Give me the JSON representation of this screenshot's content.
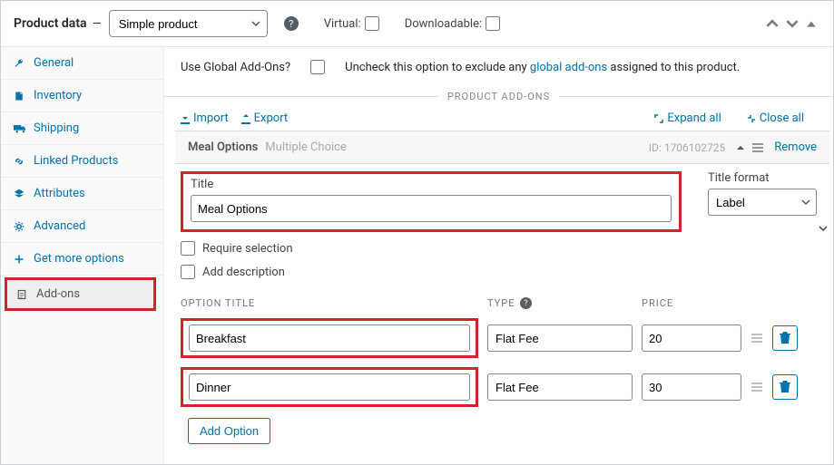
{
  "header": {
    "pd_label": "Product data",
    "dash": "—",
    "product_type": "Simple product",
    "virtual_label": "Virtual:",
    "downloadable_label": "Downloadable:"
  },
  "tabs": {
    "general": "General",
    "inventory": "Inventory",
    "shipping": "Shipping",
    "linked": "Linked Products",
    "attributes": "Attributes",
    "advanced": "Advanced",
    "more": "Get more options",
    "addons": "Add-ons"
  },
  "global": {
    "use_label": "Use Global Add-Ons?",
    "hint_pre": "Uncheck this option to exclude any ",
    "hint_link": "global add-ons",
    "hint_post": " assigned to this product."
  },
  "section": {
    "title": "PRODUCT ADD-ONS"
  },
  "toolbar": {
    "import": "Import",
    "export": "Export",
    "expand": "Expand all",
    "close": "Close all"
  },
  "addon": {
    "name": "Meal Options",
    "subtitle": "Multiple Choice",
    "id_label": "ID: 1706102725",
    "remove": "Remove",
    "title_label": "Title",
    "title_value": "Meal Options",
    "format_label": "Title format",
    "format_value": "Label",
    "require_label": "Require selection",
    "adddesc_label": "Add description",
    "col_option_title": "OPTION TITLE",
    "col_type": "TYPE",
    "col_price": "PRICE",
    "add_option": "Add Option",
    "options": [
      {
        "title": "Breakfast",
        "type": "Flat Fee",
        "price": "20"
      },
      {
        "title": "Dinner",
        "type": "Flat Fee",
        "price": "30"
      }
    ]
  }
}
